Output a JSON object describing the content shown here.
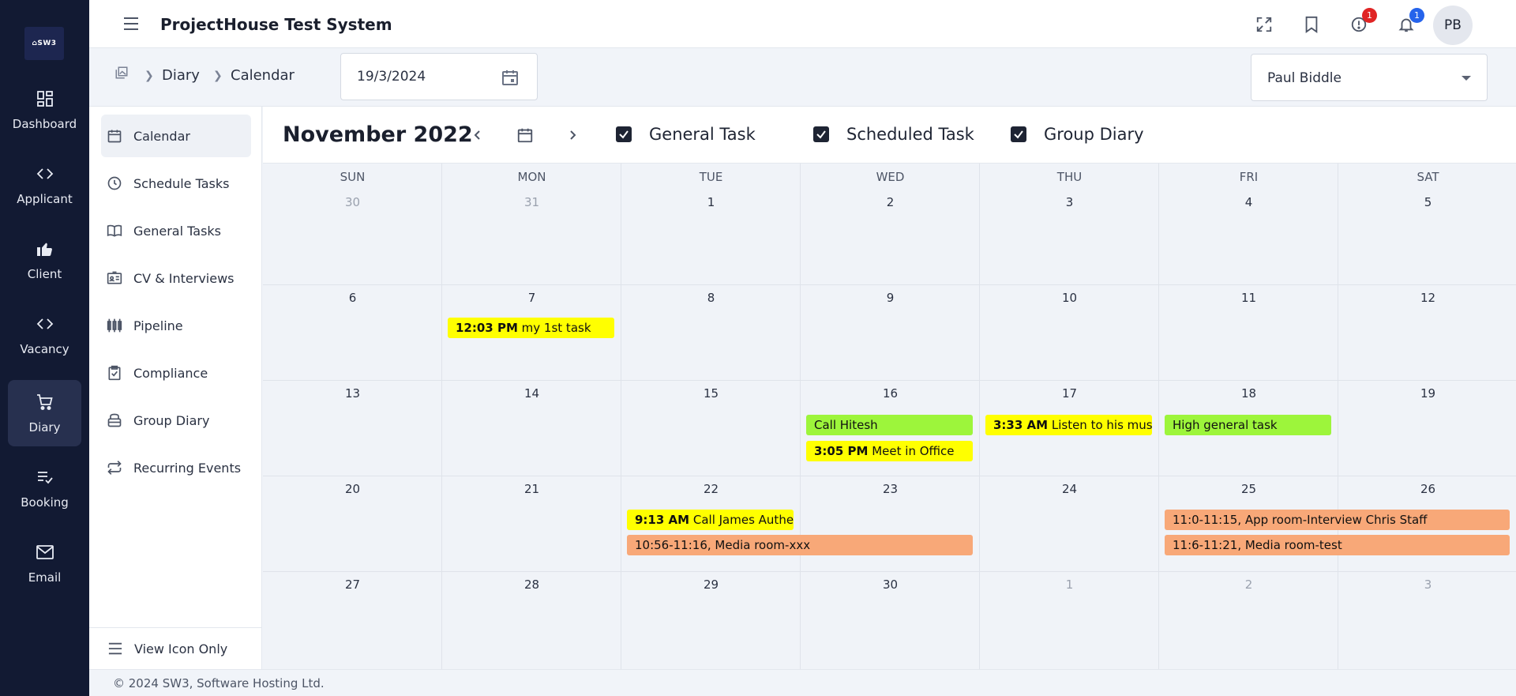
{
  "app": {
    "title": "ProjectHouse Test System",
    "logo_text": "⌂SW3"
  },
  "rail": {
    "items": [
      {
        "label": "Dashboard",
        "icon": "dashboard-icon"
      },
      {
        "label": "Applicant",
        "icon": "code-icon"
      },
      {
        "label": "Client",
        "icon": "thumbs-up-icon"
      },
      {
        "label": "Vacancy",
        "icon": "code-icon"
      },
      {
        "label": "Diary",
        "icon": "cart-icon",
        "active": true
      },
      {
        "label": "Booking",
        "icon": "list-check-icon"
      },
      {
        "label": "Email",
        "icon": "mail-icon"
      }
    ]
  },
  "topbar": {
    "alerts_count": "1",
    "notifications_count": "1",
    "avatar_initials": "PB"
  },
  "breadcrumb": {
    "items": [
      "Diary",
      "Calendar"
    ]
  },
  "date_field": {
    "value": "19/3/2024"
  },
  "user_select": {
    "value": "Paul Biddle"
  },
  "side_menu": {
    "items": [
      {
        "label": "Calendar",
        "icon": "calendar-icon",
        "active": true
      },
      {
        "label": "Schedule Tasks",
        "icon": "clock-icon"
      },
      {
        "label": "General Tasks",
        "icon": "book-icon"
      },
      {
        "label": "CV & Interviews",
        "icon": "id-card-icon"
      },
      {
        "label": "Pipeline",
        "icon": "pipeline-icon"
      },
      {
        "label": "Compliance",
        "icon": "clipboard-check-icon"
      },
      {
        "label": "Group Diary",
        "icon": "group-diary-icon"
      },
      {
        "label": "Recurring Events",
        "icon": "repeat-icon"
      }
    ],
    "bottom_label": "View Icon Only"
  },
  "calendar": {
    "month_title": "November 2022",
    "filters": [
      "General Task",
      "Scheduled Task",
      "Group Diary"
    ],
    "weekdays": [
      "SUN",
      "MON",
      "TUE",
      "WED",
      "THU",
      "FRI",
      "SAT"
    ],
    "weeks": [
      [
        "30",
        "31",
        "1",
        "2",
        "3",
        "4",
        "5"
      ],
      [
        "6",
        "7",
        "8",
        "9",
        "10",
        "11",
        "12"
      ],
      [
        "13",
        "14",
        "15",
        "16",
        "17",
        "18",
        "19"
      ],
      [
        "20",
        "21",
        "22",
        "23",
        "24",
        "25",
        "26"
      ],
      [
        "27",
        "28",
        "29",
        "30",
        "1",
        "2",
        "3"
      ]
    ],
    "events": [
      {
        "time": "12:03 PM",
        "text": "my 1st task",
        "color": "#ffff00"
      },
      {
        "time": "",
        "text": "Call Hitesh",
        "color": "#9df53b"
      },
      {
        "time": "3:05 PM",
        "text": "Meet in Office",
        "color": "#ffff00"
      },
      {
        "time": "3:33 AM",
        "text": "Listen to his music",
        "color": "#ffff00"
      },
      {
        "time": "",
        "text": "High general task",
        "color": "#9df53b"
      },
      {
        "time": "9:13 AM",
        "text": "Call James Authentication",
        "color": "#ffff00"
      },
      {
        "time": "",
        "text": "10:56-11:16, Media room-xxx",
        "color": "#f8a878"
      },
      {
        "time": "",
        "text": "11:0-11:15, App room-Interview Chris Staff",
        "color": "#f8a878"
      },
      {
        "time": "",
        "text": "11:6-11:21, Media room-test",
        "color": "#f8a878"
      }
    ]
  },
  "footer": {
    "text": "© 2024 SW3, Software Hosting Ltd."
  }
}
